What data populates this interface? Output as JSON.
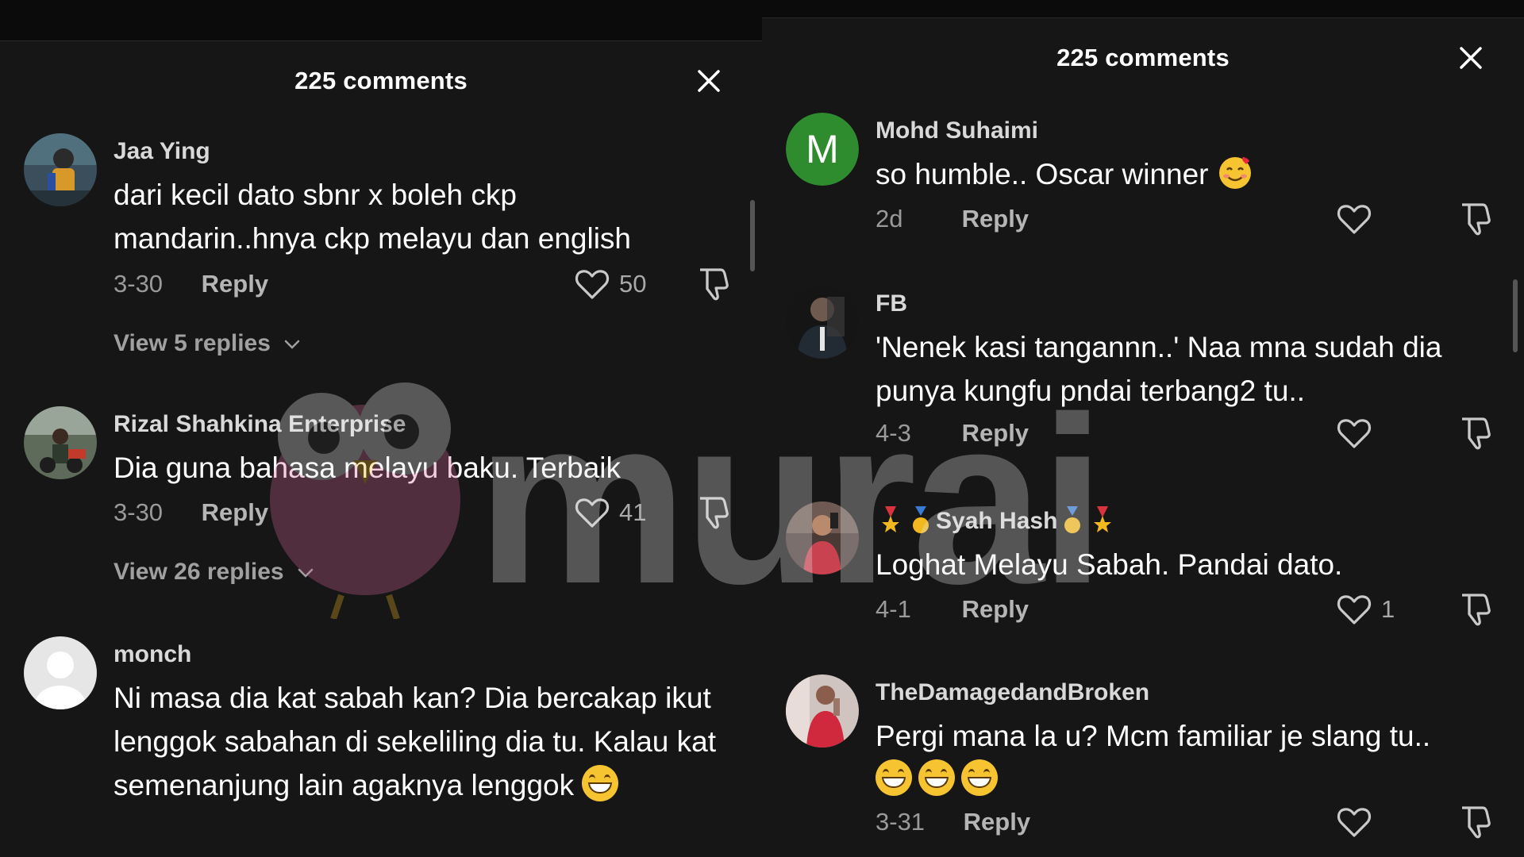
{
  "left_panel": {
    "title": "225 comments",
    "comments": [
      {
        "username": "Jaa Ying",
        "text": "dari kecil dato sbnr x boleh ckp mandarin..hnya ckp melayu dan english",
        "date": "3-30",
        "reply_label": "Reply",
        "likes": "50",
        "view_replies": "View 5 replies",
        "avatar": "photo"
      },
      {
        "username": "Rizal Shahkina Enterprise",
        "text": "Dia guna bahasa melayu baku. Terbaik",
        "date": "3-30",
        "reply_label": "Reply",
        "likes": "41",
        "view_replies": "View 26 replies",
        "avatar": "photo"
      },
      {
        "username": "monch",
        "text": "Ni masa dia kat sabah kan? Dia bercakap ikut lenggok sabahan di sekeliling dia tu. Kalau kat semenanjung lain agaknya lenggok",
        "emoji": "grinning-face",
        "avatar": "default-silhouette"
      }
    ]
  },
  "right_panel": {
    "title": "225 comments",
    "comments": [
      {
        "username": "Mohd Suhaimi",
        "avatar_letter": "M",
        "text": "so humble.. Oscar winner",
        "emoji": "smiling-face-with-hearts",
        "date": "2d",
        "reply_label": "Reply",
        "likes": ""
      },
      {
        "username": "FB",
        "text": "'Nenek kasi tangannn..' Naa mna sudah dia punya kungfu pndai terbang2 tu..",
        "date": "4-3",
        "reply_label": "Reply",
        "likes": "",
        "avatar": "photo"
      },
      {
        "username": "Syah Hash",
        "username_decor": "medal-emojis",
        "text": "Loghat Melayu Sabah. Pandai dato.",
        "date": "4-1",
        "reply_label": "Reply",
        "likes": "1",
        "avatar": "photo"
      },
      {
        "username": "TheDamagedandBroken",
        "text": "Pergi mana la u? Mcm familiar je slang tu..",
        "emoji": "grinning-face x3",
        "date": "3-31",
        "reply_label": "Reply",
        "likes": "",
        "avatar": "photo"
      }
    ]
  },
  "watermark": {
    "text": "murai",
    "icon": "owl-logo"
  },
  "colors": {
    "background": "#161616",
    "text_primary": "#ffffff",
    "text_secondary": "#9a9a9a",
    "avatar_letter_bg": "#2e8b2e"
  }
}
